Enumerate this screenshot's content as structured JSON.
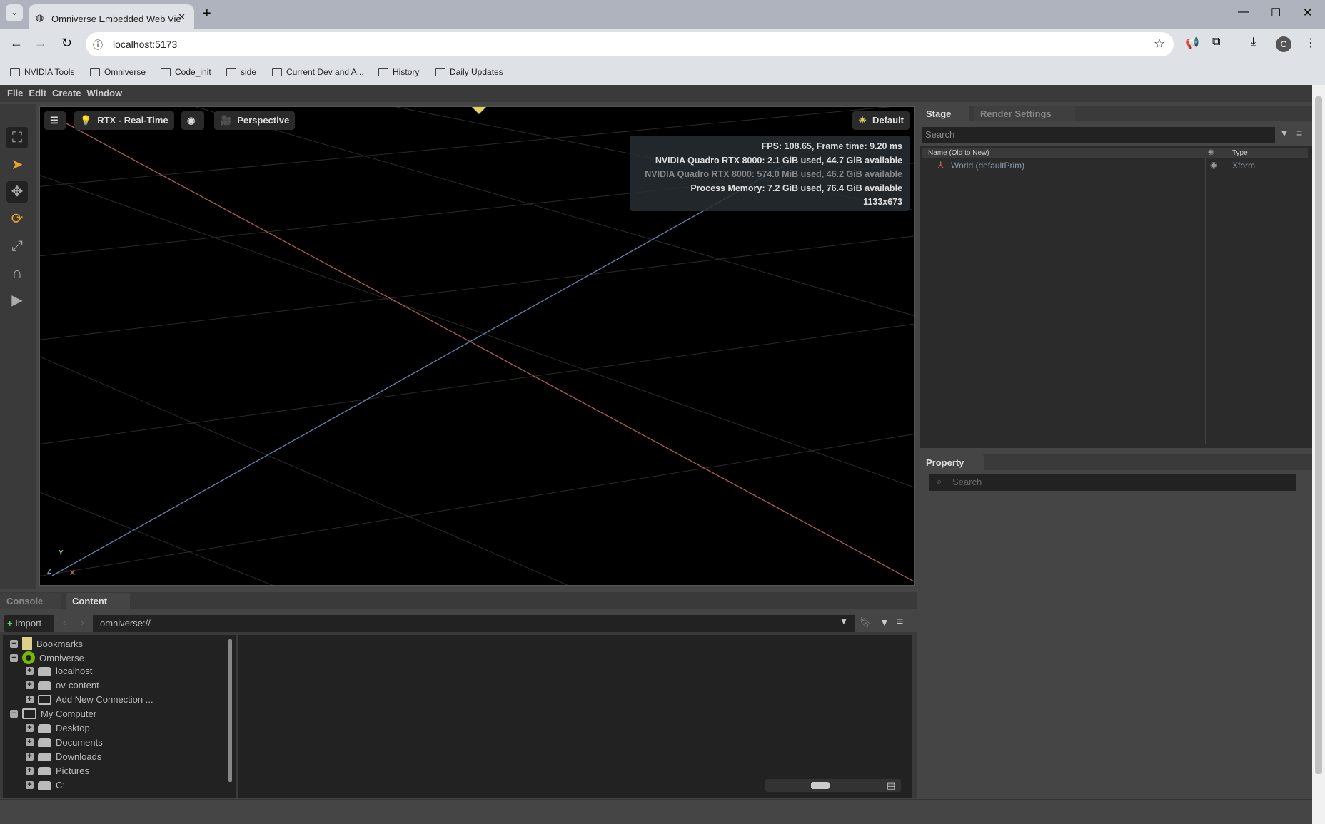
{
  "browser": {
    "tab_title": "Omniverse Embedded Web Vie",
    "url": "localhost:5173",
    "bookmarks": [
      "NVIDIA Tools",
      "Omniverse",
      "Code_init",
      "side",
      "Current Dev and A...",
      "History",
      "Daily Updates"
    ],
    "profile_initial": "C"
  },
  "menu": [
    "File",
    "Edit",
    "Create",
    "Window"
  ],
  "viewport": {
    "render_mode": "RTX - Real-Time",
    "camera": "Perspective",
    "lighting": "Default",
    "stats": [
      "FPS: 108.65, Frame time: 9.20 ms",
      "NVIDIA Quadro RTX 8000: 2.1 GiB used, 44.7 GiB available",
      "NVIDIA Quadro RTX 8000: 574.0 MiB used, 46.2 GiB available",
      "Process Memory: 7.2 GiB used, 76.4 GiB available",
      "1133x673"
    ],
    "axes": {
      "y": "Y",
      "z": "Z",
      "x": "X"
    }
  },
  "stage": {
    "tabs": [
      "Stage",
      "Render Settings"
    ],
    "search_placeholder": "Search",
    "columns": {
      "name": "Name (Old to New)",
      "type": "Type"
    },
    "rows": [
      {
        "name": "World (defaultPrim)",
        "type": "Xform"
      }
    ]
  },
  "property": {
    "tab": "Property",
    "search_placeholder": "Search"
  },
  "content": {
    "tabs": [
      "Console",
      "Content"
    ],
    "import_label": "Import",
    "path": "omniverse://",
    "tree": [
      {
        "label": "Bookmarks",
        "level": 0,
        "icon": "bookmark-icon"
      },
      {
        "label": "Omniverse",
        "level": 0,
        "icon": "omniverse-icon"
      },
      {
        "label": "localhost",
        "level": 1,
        "icon": "drive-icon"
      },
      {
        "label": "ov-content",
        "level": 1,
        "icon": "drive-icon"
      },
      {
        "label": "Add New Connection ...",
        "level": 1,
        "icon": "add-connection-icon"
      },
      {
        "label": "My Computer",
        "level": 0,
        "icon": "computer-icon"
      },
      {
        "label": "Desktop",
        "level": 1,
        "icon": "drive-icon"
      },
      {
        "label": "Documents",
        "level": 1,
        "icon": "drive-icon"
      },
      {
        "label": "Downloads",
        "level": 1,
        "icon": "drive-icon"
      },
      {
        "label": "Pictures",
        "level": 1,
        "icon": "drive-icon"
      },
      {
        "label": "C:",
        "level": 1,
        "icon": "drive-icon"
      }
    ]
  },
  "colors": {
    "x_axis": "#b05a5a",
    "z_axis": "#5a88b0",
    "omniverse_green": "#76b900",
    "bookmark_yellow": "#e0cf8a"
  }
}
